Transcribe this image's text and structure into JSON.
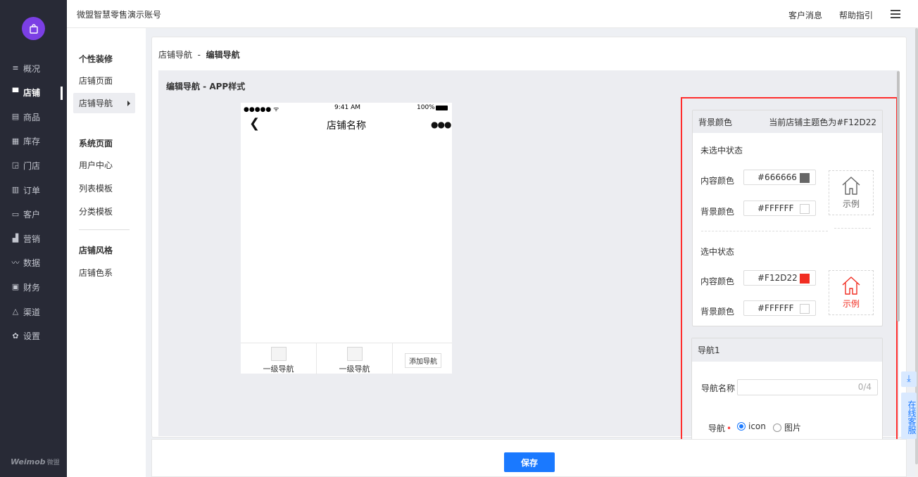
{
  "header": {
    "account_name": "微盟智慧零售演示账号",
    "customer_message": "客户消息",
    "help_guide": "帮助指引"
  },
  "brand": {
    "name": "Weimob",
    "suffix": "微盟"
  },
  "leftnav": [
    {
      "label": "概况",
      "icon": "list-icon"
    },
    {
      "label": "店铺",
      "icon": "shop-icon",
      "active": true
    },
    {
      "label": "商品",
      "icon": "goods-icon"
    },
    {
      "label": "库存",
      "icon": "grid-icon"
    },
    {
      "label": "门店",
      "icon": "store-icon"
    },
    {
      "label": "订单",
      "icon": "order-icon"
    },
    {
      "label": "客户",
      "icon": "customer-icon"
    },
    {
      "label": "营销",
      "icon": "chart-icon"
    },
    {
      "label": "数据",
      "icon": "data-icon"
    },
    {
      "label": "财务",
      "icon": "finance-icon"
    },
    {
      "label": "渠道",
      "icon": "channel-icon"
    },
    {
      "label": "设置",
      "icon": "gear-icon"
    }
  ],
  "subnav": {
    "group1": "个性装修",
    "items1": [
      "店铺页面",
      "店铺导航"
    ],
    "group2": "系统页面",
    "items2": [
      "用户中心",
      "列表模板",
      "分类模板"
    ],
    "group3": "店铺风格",
    "items3": [
      "店铺色系"
    ]
  },
  "breadcrumb": {
    "parent": "店铺导航",
    "sep": "-",
    "current": "编辑导航"
  },
  "edit_title": "编辑导航 - APP样式",
  "phone": {
    "signal": "●●●●● ᯤ",
    "time": "9:41 AM",
    "battery": "100%",
    "title": "店铺名称",
    "tabs": [
      "一级导航",
      "一级导航"
    ],
    "add_nav": "添加导航"
  },
  "bg_panel": {
    "title": "背景颜色",
    "theme_note": "当前店铺主题色为#F12D22",
    "unselected_label": "未选中状态",
    "selected_label": "选中状态",
    "content_color_label": "内容颜色",
    "bg_color_label": "背景颜色",
    "unselected_content": "#666666",
    "unselected_bg": "#FFFFFF",
    "selected_content": "#F12D22",
    "selected_bg": "#FFFFFF",
    "sample_label": "示例"
  },
  "nav_panel": {
    "title": "导航1",
    "name_label": "导航名称",
    "name_counter": "0/4",
    "type_label": "导航",
    "opt_icon": "icon",
    "opt_image": "图片"
  },
  "float": {
    "customer_service": "在线客服"
  },
  "save_label": "保存"
}
